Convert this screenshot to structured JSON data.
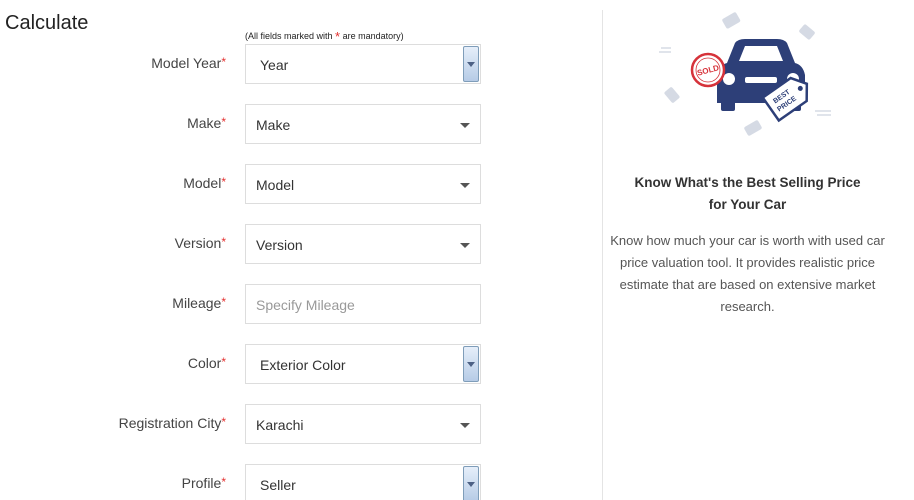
{
  "title": "Calculate",
  "mandatory_note": {
    "before": "(All fields marked with ",
    "star": "*",
    "after": " are mandatory)"
  },
  "fields": [
    {
      "label": "Model Year",
      "value": "Year",
      "kind": "native"
    },
    {
      "label": "Make",
      "value": "Make",
      "kind": "styled"
    },
    {
      "label": "Model",
      "value": "Model",
      "kind": "styled"
    },
    {
      "label": "Version",
      "value": "Version",
      "kind": "styled"
    },
    {
      "label": "Mileage",
      "placeholder": "Specify Mileage",
      "kind": "input"
    },
    {
      "label": "Color",
      "value": "Exterior Color",
      "kind": "native"
    },
    {
      "label": "Registration City",
      "value": "Karachi",
      "kind": "styled"
    },
    {
      "label": "Profile",
      "value": "Seller",
      "kind": "native"
    }
  ],
  "required_mark": "*",
  "sidebar": {
    "heading_line1": "Know What's the Best Selling Price",
    "heading_line2": "for Your Car",
    "text": "Know how much your car is worth with used car price valuation tool. It provides realistic price estimate that are based on extensive market research.",
    "badge_sold": "SOLD",
    "tag_line1": "BEST",
    "tag_line2": "PRICE"
  },
  "colors": {
    "accent_navy": "#2d3f78",
    "required_red": "#e3302f",
    "sold_red": "#d6323a"
  }
}
